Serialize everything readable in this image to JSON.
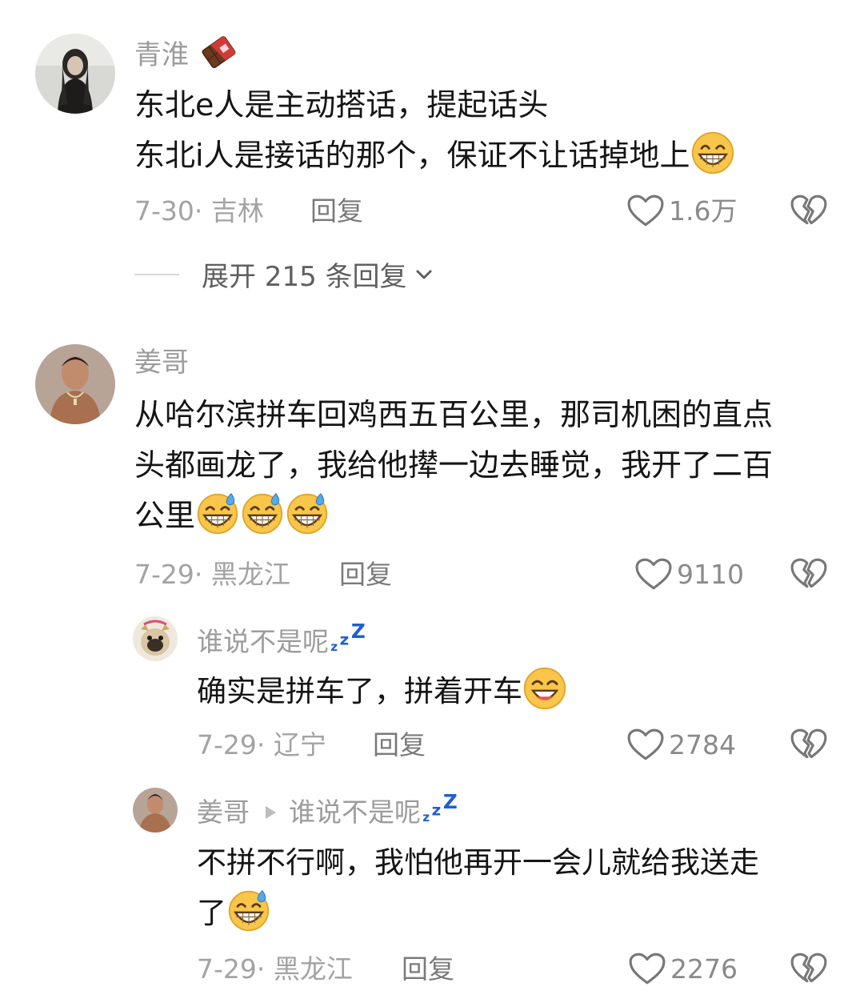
{
  "comments": [
    {
      "username": "青淮",
      "badge_icon": "chocolate-bar-icon",
      "lines": [
        "东北e人是主动搭话，提起话头",
        "东北i人是接话的那个，保证不让话掉地上"
      ],
      "line_emojis": [
        "",
        "grin-emoji"
      ],
      "date_location": "7-30· 吉林",
      "reply_label": "回复",
      "likes": "1.6万",
      "expand_label": "展开 215 条回复"
    },
    {
      "username": "姜哥",
      "lines": [
        "从哈尔滨拼车回鸡西五百公里，那司机困的直点",
        "头都画龙了，我给他撵一边去睡觉，我开了二百",
        "公里"
      ],
      "line_emojis": [
        "",
        "",
        "sweat-grin-emoji x3"
      ],
      "date_location": "7-29· 黑龙江",
      "reply_label": "回复",
      "likes": "9110"
    }
  ],
  "replies": [
    {
      "username": "谁说不是呢",
      "name_suffix": "zzz",
      "text": "确实是拼车了，拼着开车",
      "text_emoji": "grin-squint-emoji",
      "date_location": "7-29· 辽宁",
      "reply_label": "回复",
      "likes": "2784"
    },
    {
      "username": "姜哥",
      "reply_to": "谁说不是呢",
      "reply_to_suffix": "zzz",
      "lines": [
        "不拼不行啊，我怕他再开一会儿就给我送走",
        "了"
      ],
      "line_emojis": [
        "",
        "sweat-grin-emoji"
      ],
      "date_location": "7-29· 黑龙江",
      "reply_label": "回复",
      "likes": "2276"
    }
  ],
  "colors": {
    "muted": "#9c9c9c",
    "text": "#151515",
    "emoji_yellow": "#f7c64a",
    "sweat_blue": "#5aa8e8",
    "zzz_blue": "#1f5fd0"
  }
}
